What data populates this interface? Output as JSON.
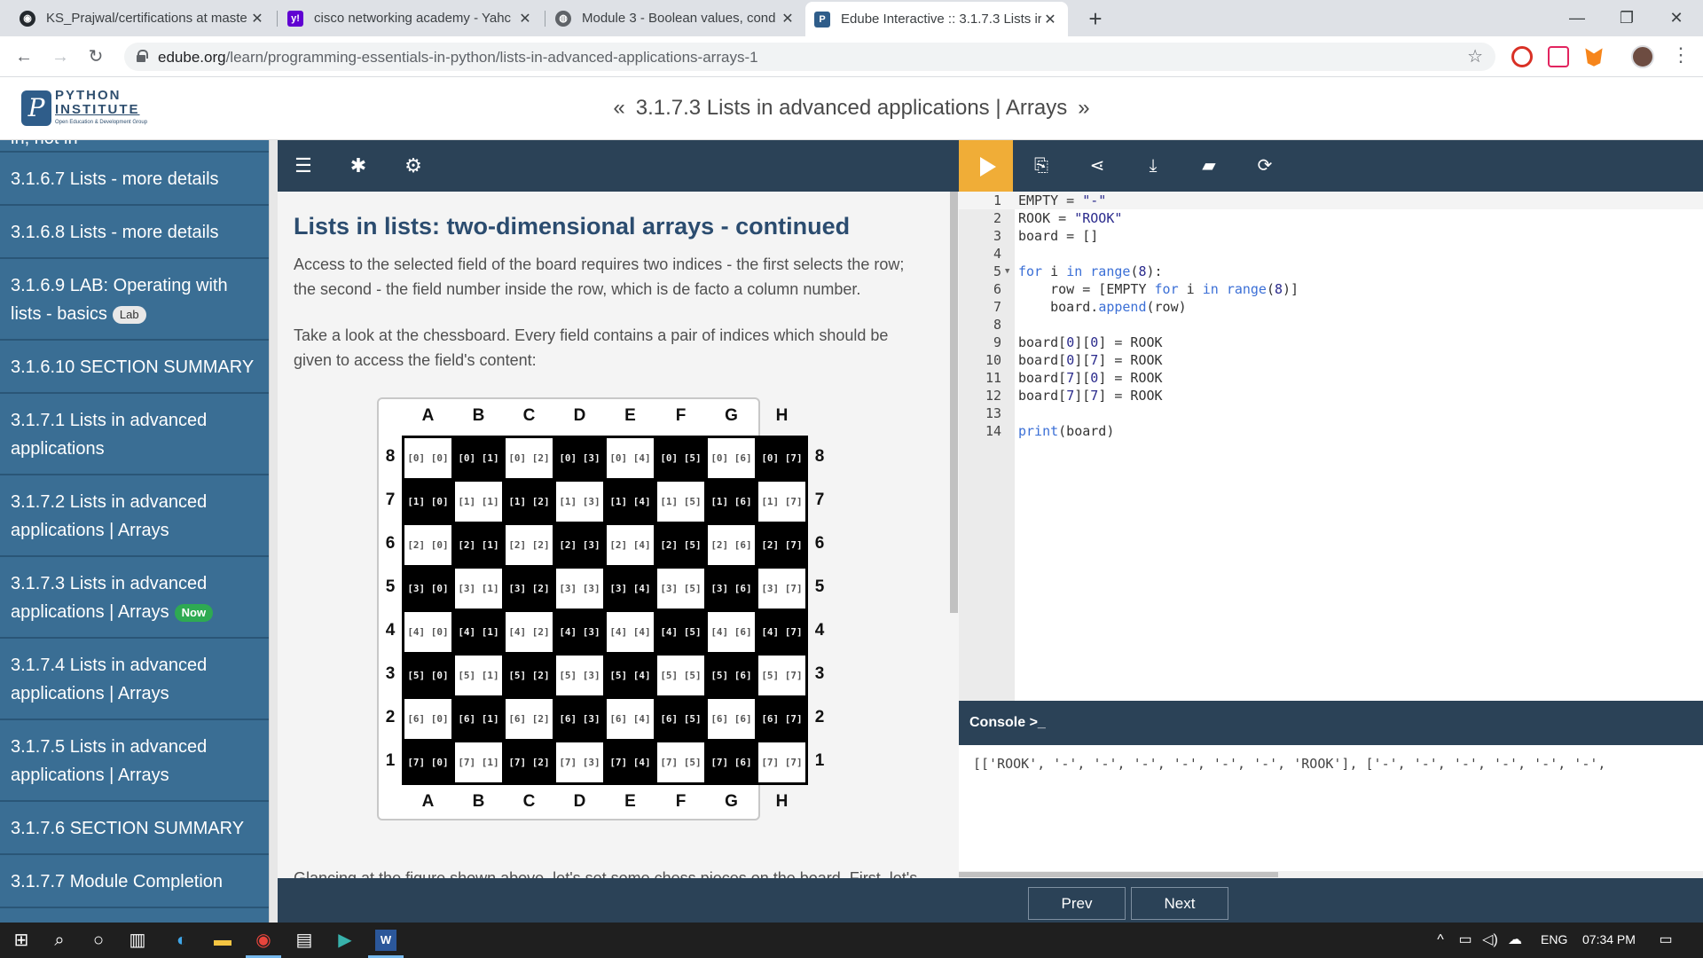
{
  "browser": {
    "tabs": [
      {
        "title": "KS_Prajwal/certifications at maste",
        "icon": "github-icon"
      },
      {
        "title": "cisco networking academy - Yahc",
        "icon": "yahoo-icon"
      },
      {
        "title": "Module 3 - Boolean values, cond",
        "icon": "globe-icon"
      },
      {
        "title": "Edube Interactive :: 3.1.7.3 Lists ir",
        "icon": "python-institute-icon"
      }
    ],
    "url_host": "edube.org",
    "url_path": "/learn/programming-essentials-in-python/lists-in-advanced-applications-arrays-1"
  },
  "site": {
    "logo_line1": "PYTHON",
    "logo_line2": "INSTITUTE",
    "logo_sub": "Open Education & Development Group",
    "logo_mark": "P",
    "page_title": "3.1.7.3 Lists in advanced applications | Arrays",
    "prev_chevron": "«",
    "next_chevron": "»"
  },
  "sidebar": {
    "items": [
      {
        "label": "in, not in",
        "badge": null
      },
      {
        "label": "3.1.6.7 Lists - more details",
        "badge": null
      },
      {
        "label": "3.1.6.8 Lists - more details",
        "badge": null
      },
      {
        "label": "3.1.6.9 LAB: Operating with lists - basics",
        "badge": "Lab"
      },
      {
        "label": "3.1.6.10 SECTION SUMMARY",
        "badge": null
      },
      {
        "label": "3.1.7.1 Lists in advanced applications",
        "badge": null
      },
      {
        "label": "3.1.7.2 Lists in advanced applications | Arrays",
        "badge": null
      },
      {
        "label": "3.1.7.3 Lists in advanced applications | Arrays",
        "badge": "Now"
      },
      {
        "label": "3.1.7.4 Lists in advanced applications | Arrays",
        "badge": null
      },
      {
        "label": "3.1.7.5 Lists in advanced applications | Arrays",
        "badge": null
      },
      {
        "label": "3.1.7.6 SECTION SUMMARY",
        "badge": null
      },
      {
        "label": "3.1.7.7 Module Completion",
        "badge": null
      }
    ]
  },
  "lesson": {
    "heading": "Lists in lists: two-dimensional arrays - continued",
    "para1_line1": "Access to the selected field of the board requires two indices - the first selects the row;",
    "para1_line2": "the second - the field number inside the row, which is de facto a column number.",
    "para2_line1": "Take a look at the chessboard. Every field contains a pair of indices which should be",
    "para2_line2": "given to access the field's content:",
    "cut_text": "Glancing at the figure shown above, let's set some chess pieces on the board. First, let's",
    "board": {
      "columns": [
        "A",
        "B",
        "C",
        "D",
        "E",
        "F",
        "G",
        "H"
      ],
      "rows": [
        "8",
        "7",
        "6",
        "5",
        "4",
        "3",
        "2",
        "1"
      ],
      "cell_format": "[r] [c]"
    }
  },
  "editor": {
    "lines": [
      "EMPTY = \"-\"",
      "ROOK = \"ROOK\"",
      "board = []",
      "",
      "for i in range(8):",
      "    row = [EMPTY for i in range(8)]",
      "    board.append(row)",
      "",
      "board[0][0] = ROOK",
      "board[0][7] = ROOK",
      "board[7][0] = ROOK",
      "board[7][7] = ROOK",
      "",
      "print(board)"
    ],
    "console_title": "Console >_",
    "console_output": "[['ROOK', '-', '-', '-', '-', '-', '-', 'ROOK'], ['-', '-', '-', '-', '-', '-',"
  },
  "nav": {
    "prev": "Prev",
    "next": "Next"
  },
  "taskbar": {
    "lang": "ENG",
    "time": "07:34 PM"
  },
  "colors": {
    "sidebar": "#3a6e94",
    "toolbar": "#2b4257",
    "run": "#f0ad37",
    "heading": "#2b4c6f",
    "now_badge": "#2eaa52"
  }
}
